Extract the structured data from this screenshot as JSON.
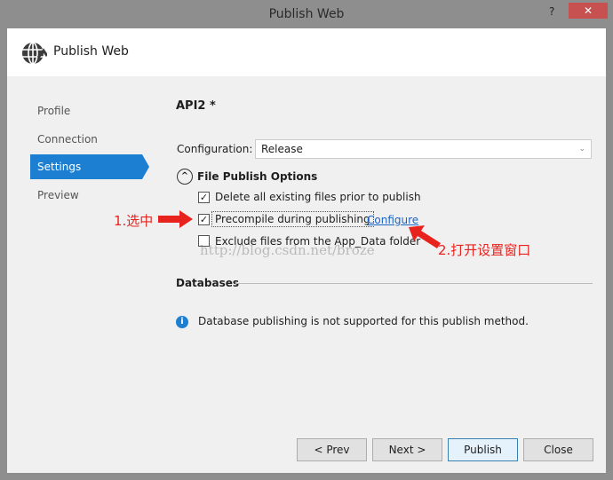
{
  "window": {
    "title": "Publish Web",
    "help": "?",
    "close": "✕"
  },
  "header": {
    "title": "Publish Web",
    "icon": "globe-publish-icon"
  },
  "sidebar": {
    "items": [
      {
        "label": "Profile"
      },
      {
        "label": "Connection"
      },
      {
        "label": "Settings",
        "selected": true
      },
      {
        "label": "Preview"
      }
    ]
  },
  "main": {
    "profile_name": "API2 *",
    "configuration": {
      "label": "Configuration:",
      "value": "Release"
    },
    "file_publish": {
      "title": "File Publish Options",
      "options": [
        {
          "label": "Delete all existing files prior to publish",
          "checked": true
        },
        {
          "label": "Precompile during publishing",
          "checked": true,
          "link": "Configure"
        },
        {
          "label": "Exclude files from the App_Data folder",
          "checked": false
        }
      ]
    },
    "databases": {
      "title": "Databases",
      "info": "Database publishing is not supported for this publish method."
    }
  },
  "annotations": {
    "step1": "1.选中",
    "step2": "2.打开设置窗口",
    "accent": "#e8231e"
  },
  "watermark": "http://blog.csdn.net/broze",
  "buttons": {
    "prev": "< Prev",
    "next": "Next >",
    "publish": "Publish",
    "close": "Close"
  }
}
